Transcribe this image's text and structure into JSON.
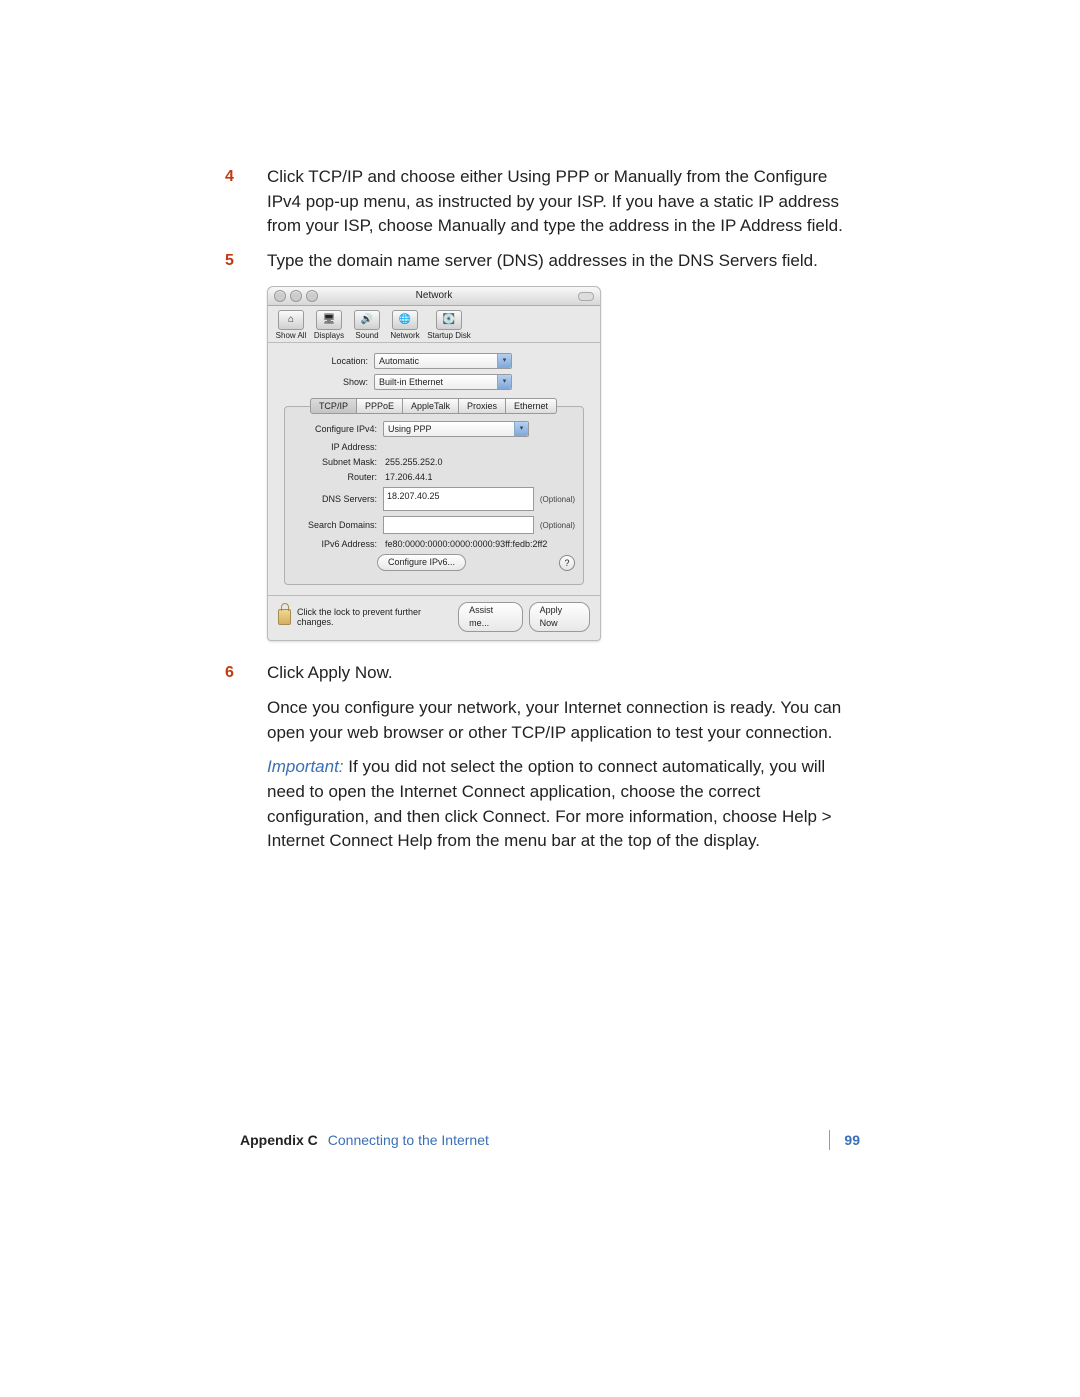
{
  "steps": {
    "s4": {
      "num": "4",
      "text": "Click TCP/IP and choose either Using PPP or Manually from the Configure IPv4 pop-up menu, as instructed by your ISP. If you have a static IP address from your ISP, choose Manually and type the address in the IP Address field."
    },
    "s5": {
      "num": "5",
      "text": "Type the domain name server (DNS) addresses in the DNS Servers field."
    },
    "s6": {
      "num": "6",
      "text_lead": "Click Apply Now.",
      "body": "Once you configure your network, your Internet connection is ready. You can open your web browser or other TCP/IP application to test your connection.",
      "important_label": "Important:",
      "important_body": "If you did not select the option to connect automatically, you will need to open the Internet Connect application, choose the correct configuration, and then click Connect. For more information, choose Help > Internet Connect Help from the menu bar at the top of the display."
    }
  },
  "window": {
    "title": "Network",
    "toolbar": {
      "show_all": "Show All",
      "displays": "Displays",
      "sound": "Sound",
      "network": "Network",
      "startup_disk": "Startup Disk"
    },
    "location_label": "Location:",
    "location_value": "Automatic",
    "show_label": "Show:",
    "show_value": "Built-in Ethernet",
    "tabs": {
      "tcpip": "TCP/IP",
      "pppoe": "PPPoE",
      "appletalk": "AppleTalk",
      "proxies": "Proxies",
      "ethernet": "Ethernet"
    },
    "config_ipv4_label": "Configure IPv4:",
    "config_ipv4_value": "Using PPP",
    "ip_label": "IP Address:",
    "ip_value": "",
    "subnet_label": "Subnet Mask:",
    "subnet_value": "255.255.252.0",
    "router_label": "Router:",
    "router_value": "17.206.44.1",
    "dns_label": "DNS Servers:",
    "dns_value": "18.207.40.25",
    "search_label": "Search Domains:",
    "search_value": "",
    "ipv6_label": "IPv6 Address:",
    "ipv6_value": "fe80:0000:0000:0000:0000:93ff:fedb:2ff2",
    "optional": "(Optional)",
    "config_ipv6_btn": "Configure IPv6...",
    "lock_text": "Click the lock to prevent further changes.",
    "assist_btn": "Assist me...",
    "apply_btn": "Apply Now",
    "help": "?"
  },
  "footer": {
    "appendix": "Appendix C",
    "title": "Connecting to the Internet",
    "page": "99"
  }
}
